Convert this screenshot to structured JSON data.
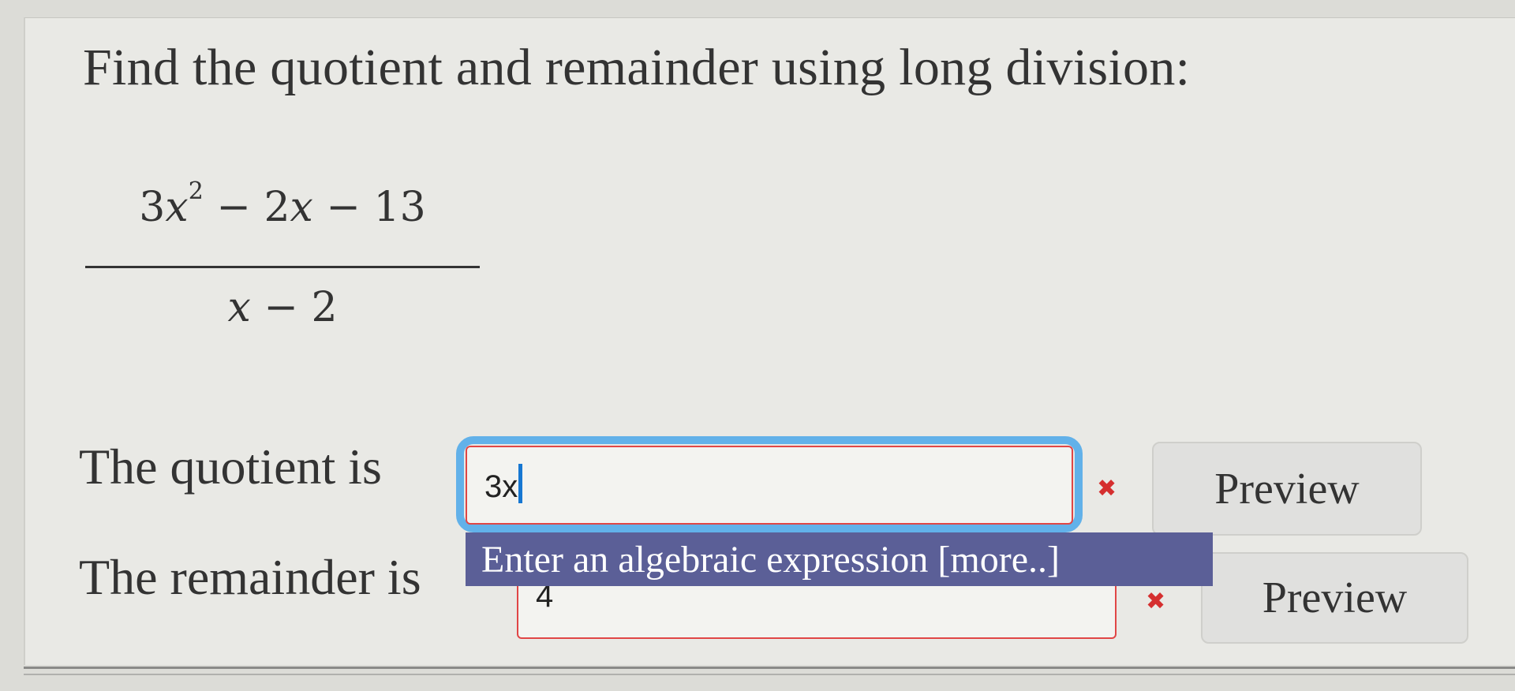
{
  "question": {
    "text": "Find the quotient and remainder using long division:"
  },
  "expression": {
    "numerator": {
      "coef1": "3",
      "var1": "x",
      "exp1": "2",
      "op1": " − ",
      "coef2": "2",
      "var2": "x",
      "op2": " − ",
      "const": "13"
    },
    "denominator": {
      "var": "x",
      "op": " − ",
      "const": "2"
    }
  },
  "quotient": {
    "label": "The quotient is",
    "value": "3x",
    "preview_label": "Preview",
    "status_icon": "x-mark"
  },
  "remainder": {
    "label": "The remainder is",
    "value": "4",
    "preview_label": "Preview",
    "status_icon": "x-mark"
  },
  "tooltip": {
    "text": "Enter an algebraic expression [more..]"
  },
  "colors": {
    "invalid_border": "#e04646",
    "focus_ring": "#62b1e9",
    "tooltip_bg": "#5b5f97",
    "error_icon": "#d52f2f"
  }
}
